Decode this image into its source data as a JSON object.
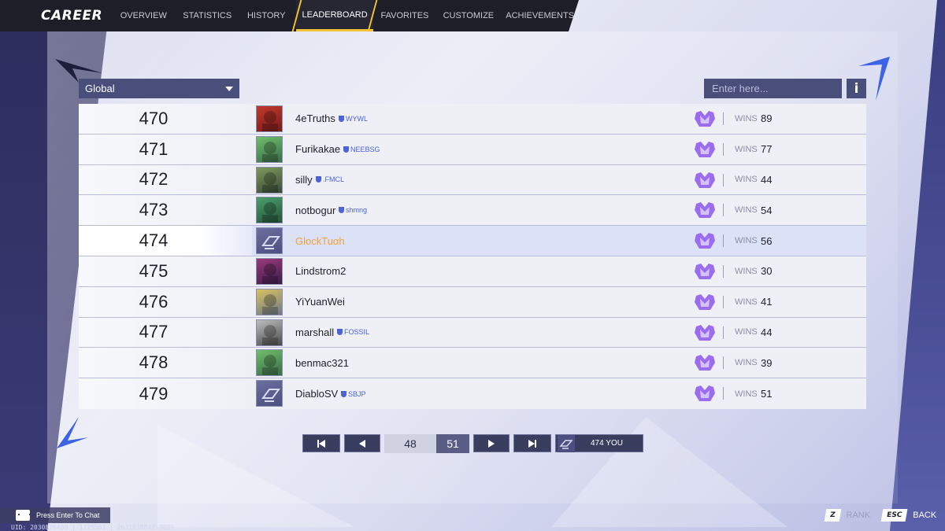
{
  "nav": {
    "title": "CAREER",
    "tabs": [
      "OVERVIEW",
      "STATISTICS",
      "HISTORY",
      "LEADERBOARD",
      "FAVORITES",
      "CUSTOMIZE",
      "ACHIEVEMENTS"
    ],
    "active_tab": "LEADERBOARD",
    "achievements_badge": "!"
  },
  "filter": {
    "scope": "Global"
  },
  "search": {
    "placeholder": "Enter here...",
    "info_label": "i"
  },
  "leaderboard": {
    "wins_label": "WINS",
    "rows": [
      {
        "rank": "470",
        "name": "4eTruths",
        "club": "WYWL",
        "wins": "89",
        "avatar": "red-hero"
      },
      {
        "rank": "471",
        "name": "Furikakae",
        "club": "NEEBSG",
        "wins": "77",
        "avatar": "green-hero"
      },
      {
        "rank": "472",
        "name": "silly",
        "club": ".FMCL",
        "wins": "44",
        "avatar": "green-armor-hero"
      },
      {
        "rank": "473",
        "name": "notbogur",
        "club": "shmng",
        "wins": "54",
        "avatar": "green-creature-hero"
      },
      {
        "rank": "474",
        "name": "GlockTuαh",
        "club": "",
        "wins": "56",
        "avatar": "default-logo",
        "is_self": true
      },
      {
        "rank": "475",
        "name": "Lindstrom2",
        "club": "",
        "wins": "30",
        "avatar": "purple-hero"
      },
      {
        "rank": "476",
        "name": "YiYuanWei",
        "club": "",
        "wins": "41",
        "avatar": "yellow-hero"
      },
      {
        "rank": "477",
        "name": "marshall",
        "club": "FOSSIL",
        "wins": "44",
        "avatar": "masked-hero"
      },
      {
        "rank": "478",
        "name": "benmac321",
        "club": "",
        "wins": "39",
        "avatar": "green-hero"
      },
      {
        "rank": "479",
        "name": "DiabloSV",
        "club": "SBJP",
        "wins": "51",
        "avatar": "default-logo"
      }
    ]
  },
  "pagination": {
    "current_page": "48",
    "total_pages": "51",
    "self_rank_label": "474 YOU"
  },
  "footer": {
    "chat_hint": "Press Enter To Chat",
    "build_info": "UID: 2030826480 | 1725561 | 2031038842-8889",
    "keys": [
      {
        "key": "Z",
        "label": "RANK"
      },
      {
        "key": "ESC",
        "label": "BACK"
      }
    ]
  },
  "colors": {
    "accent": "#f2c230",
    "self_name": "#f0a23c",
    "club_tag": "#4b63d8",
    "rank_icon": "#9b6cf0"
  }
}
